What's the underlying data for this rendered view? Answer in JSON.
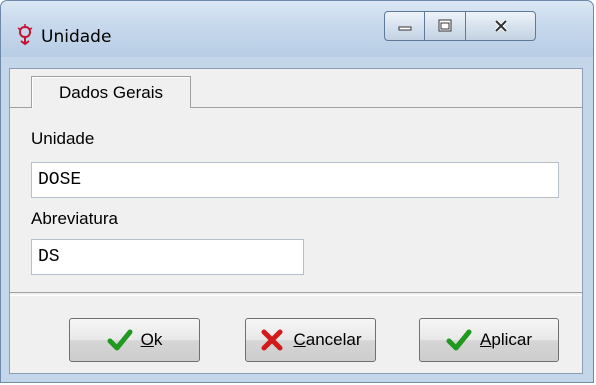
{
  "window": {
    "title": "Unidade",
    "controls": {
      "minimize_icon": "minimize-icon",
      "maximize_icon": "maximize-icon",
      "close_icon": "close-icon"
    }
  },
  "tabs": [
    {
      "label": "Dados Gerais",
      "selected": true
    }
  ],
  "form": {
    "unidade": {
      "label": "Unidade",
      "value": "DOSE"
    },
    "abreviatura": {
      "label": "Abreviatura",
      "value": "DS"
    }
  },
  "buttons": {
    "ok": {
      "mnemonic": "O",
      "rest": "k",
      "icon": "check-icon"
    },
    "cancelar": {
      "mnemonic": "C",
      "rest": "ancelar",
      "icon": "x-icon"
    },
    "aplicar": {
      "mnemonic": "A",
      "rest": "plicar",
      "icon": "check-icon"
    }
  },
  "colors": {
    "check": "#1f9a1f",
    "cancel": "#d21a1a",
    "titlebar": "#c6d8ec"
  }
}
